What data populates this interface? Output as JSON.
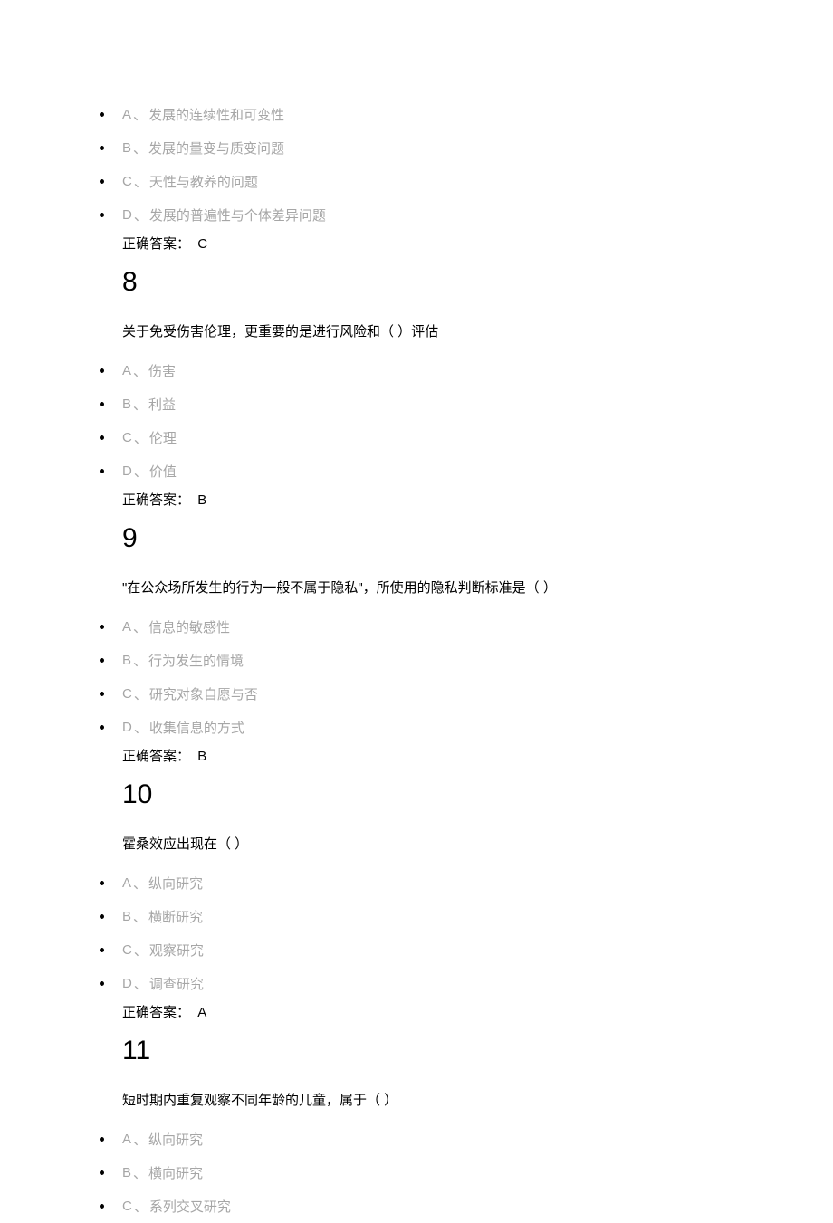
{
  "q7": {
    "options": [
      {
        "letter": "A",
        "text": "发展的连续性和可变性"
      },
      {
        "letter": "B",
        "text": "发展的量变与质变问题"
      },
      {
        "letter": "C",
        "text": "天性与教养的问题"
      },
      {
        "letter": "D",
        "text": "发展的普遍性与个体差异问题"
      }
    ],
    "answer_label": "正确答案：",
    "answer_value": "C"
  },
  "q8": {
    "number": "8",
    "question": "关于免受伤害伦理，更重要的是进行风险和（  ）评估",
    "options": [
      {
        "letter": "A",
        "text": "伤害"
      },
      {
        "letter": "B",
        "text": "利益"
      },
      {
        "letter": "C",
        "text": "伦理"
      },
      {
        "letter": "D",
        "text": "价值"
      }
    ],
    "answer_label": "正确答案：",
    "answer_value": "B"
  },
  "q9": {
    "number": "9",
    "question": "\"在公众场所发生的行为一般不属于隐私\"，所使用的隐私判断标准是（    ）",
    "options": [
      {
        "letter": "A",
        "text": "信息的敏感性"
      },
      {
        "letter": "B",
        "text": "行为发生的情境"
      },
      {
        "letter": "C",
        "text": "研究对象自愿与否"
      },
      {
        "letter": "D",
        "text": "收集信息的方式"
      }
    ],
    "answer_label": "正确答案：",
    "answer_value": "B"
  },
  "q10": {
    "number": "10",
    "question": "霍桑效应出现在（    ）",
    "options": [
      {
        "letter": "A",
        "text": "纵向研究"
      },
      {
        "letter": "B",
        "text": "横断研究"
      },
      {
        "letter": "C",
        "text": "观察研究"
      },
      {
        "letter": "D",
        "text": "调查研究"
      }
    ],
    "answer_label": "正确答案：",
    "answer_value": "A"
  },
  "q11": {
    "number": "11",
    "question": "短时期内重复观察不同年龄的儿童，属于（    ）",
    "options": [
      {
        "letter": "A",
        "text": "纵向研究"
      },
      {
        "letter": "B",
        "text": "横向研究"
      },
      {
        "letter": "C",
        "text": "系列交叉研究"
      }
    ]
  }
}
